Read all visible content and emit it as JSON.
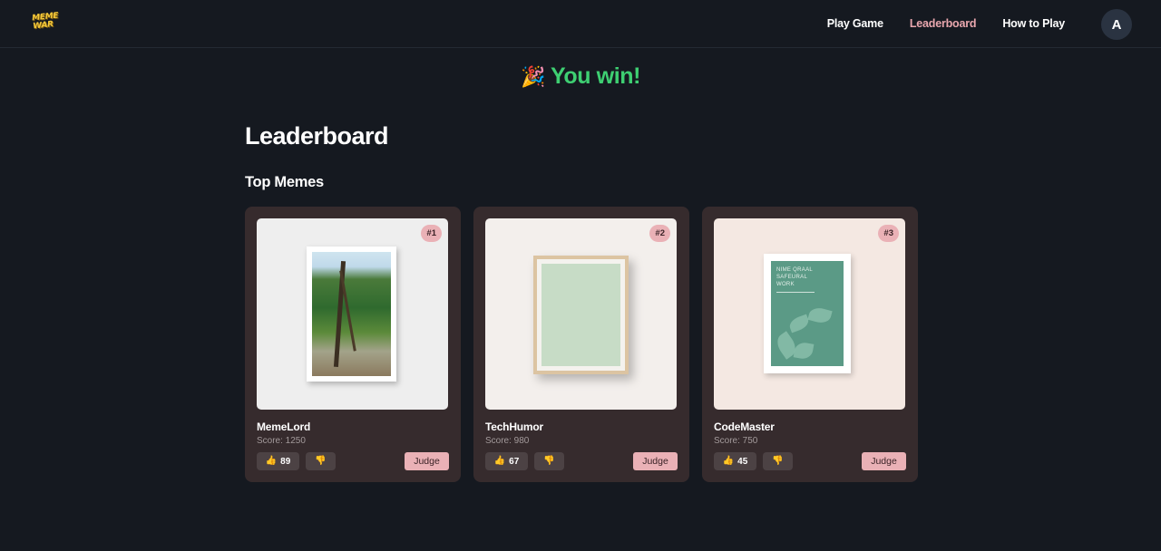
{
  "nav": {
    "logo_line1": "MEME",
    "logo_line2": "WAR",
    "links": [
      {
        "label": "Play Game",
        "active": false
      },
      {
        "label": "Leaderboard",
        "active": true
      },
      {
        "label": "How to Play",
        "active": false
      }
    ],
    "avatar_initial": "A"
  },
  "banner": {
    "icon": "party-popper-icon",
    "text": "You win!"
  },
  "page_title": "Leaderboard",
  "section_title": "Top Memes",
  "cards": [
    {
      "rank": "#1",
      "name": "MemeLord",
      "score_text": "Score: 1250",
      "upvotes": "89",
      "judge_label": "Judge",
      "image": "framed-forest-photo"
    },
    {
      "rank": "#2",
      "name": "TechHumor",
      "score_text": "Score: 980",
      "upvotes": "67",
      "judge_label": "Judge",
      "image": "wooden-frame-green-art"
    },
    {
      "rank": "#3",
      "name": "CodeMaster",
      "score_text": "Score: 750",
      "upvotes": "45",
      "judge_label": "Judge",
      "image": "botanical-poster",
      "poster_lines": [
        "NIME QRAAL",
        "SAFEURAL",
        "WORK"
      ]
    }
  ],
  "colors": {
    "background": "#151920",
    "card": "#362b2d",
    "accent_pink": "#eab1b6",
    "win_green": "#3ecf72"
  }
}
